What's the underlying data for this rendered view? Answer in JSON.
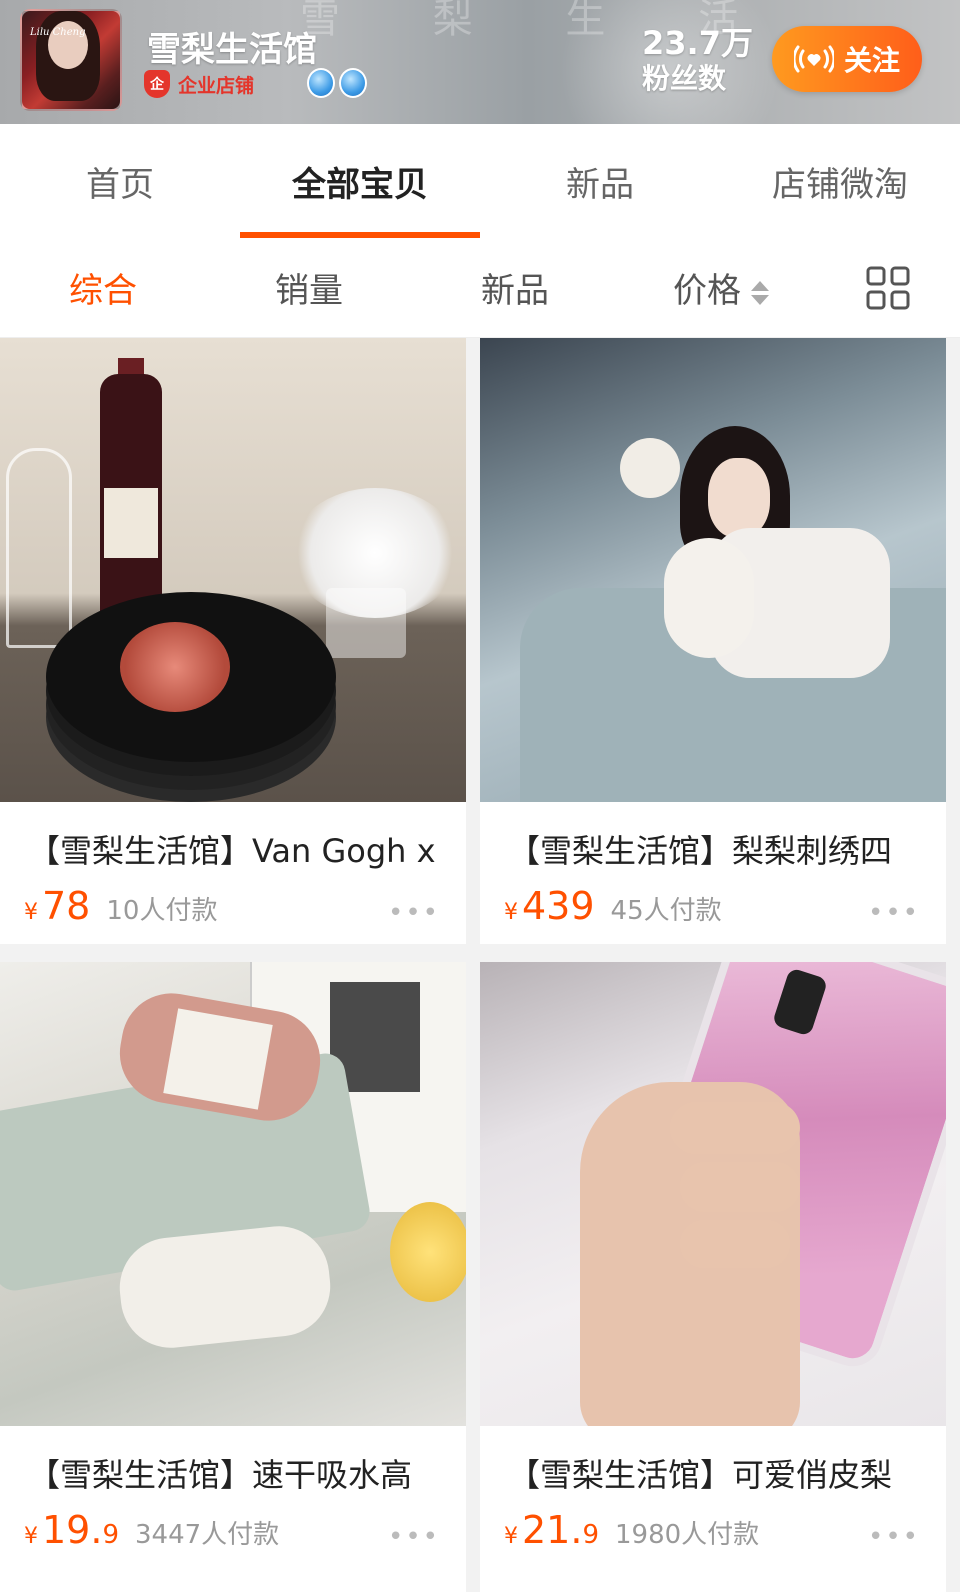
{
  "shop": {
    "bg_text": "雪 梨 生 活",
    "logo_script": "Lilu Cheng",
    "name": "雪梨生活馆",
    "badge_icon": "企",
    "badge_label": "企业店铺",
    "fans_count": "23.7万",
    "fans_label": "粉丝数",
    "follow_label": "关注"
  },
  "tabs": [
    {
      "label": "首页",
      "active": false
    },
    {
      "label": "全部宝贝",
      "active": true
    },
    {
      "label": "新品",
      "active": false
    },
    {
      "label": "店铺微淘",
      "active": false
    }
  ],
  "sort": {
    "items": [
      {
        "label": "综合",
        "active": true
      },
      {
        "label": "销量",
        "active": false
      },
      {
        "label": "新品",
        "active": false
      },
      {
        "label": "价格",
        "active": false
      }
    ],
    "view_toggle_icon": "grid-view-icon"
  },
  "products": [
    {
      "title": "【雪梨生活馆】Van Gogh x",
      "currency": "¥",
      "price": "78",
      "price_dec": "",
      "sold": "10人付款",
      "more": "•••"
    },
    {
      "title": "【雪梨生活馆】梨梨刺绣四",
      "currency": "¥",
      "price": "439",
      "price_dec": "",
      "sold": "45人付款",
      "more": "•••"
    },
    {
      "title": "【雪梨生活馆】速干吸水高",
      "currency": "¥",
      "price": "19.",
      "price_dec": "9",
      "sold": "3447人付款",
      "more": "•••"
    },
    {
      "title": "【雪梨生活馆】可爱俏皮梨",
      "currency": "¥",
      "price": "21.",
      "price_dec": "9",
      "sold": "1980人付款",
      "more": "•••"
    }
  ],
  "colors": {
    "accent": "#ff5000",
    "follow_gradient_start": "#ff9a1f",
    "follow_gradient_end": "#ff5e1a",
    "enterprise_red": "#e4352b"
  }
}
